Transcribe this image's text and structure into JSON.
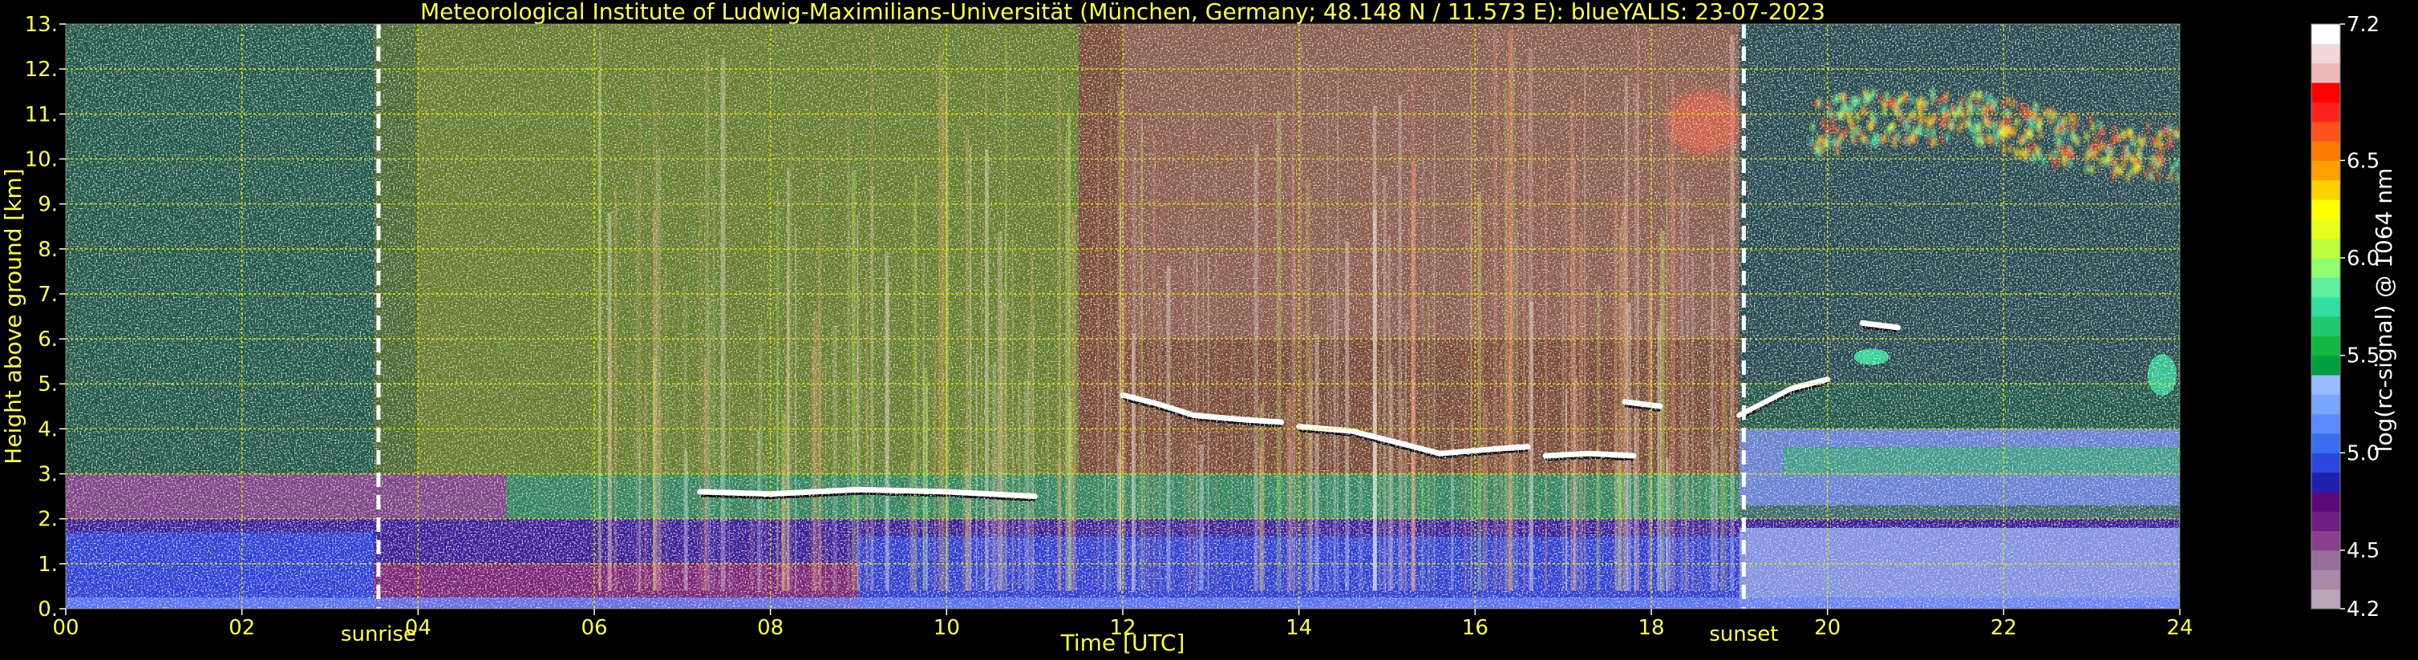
{
  "colors": {
    "background": "#000000",
    "title": "#ffff33",
    "axis_text": "#ffff33",
    "grid": "#e6e600",
    "marker": "#ffffff",
    "colorbar_text": "#ffffff"
  },
  "chart_data": {
    "type": "heatmap",
    "title": "Meteorological Institute of Ludwig-Maximilians-Universität (München, Germany; 48.148 N / 11.573 E):    blueYALIS: 23-07-2023",
    "xlabel": "Time [UTC]",
    "ylabel": "Height above ground [km]",
    "xlim": [
      0,
      24
    ],
    "ylim": [
      0,
      13
    ],
    "grid": true,
    "x_ticks": [
      0,
      2,
      4,
      6,
      8,
      10,
      12,
      14,
      16,
      18,
      20,
      22,
      24
    ],
    "x_tick_labels": [
      "00",
      "02",
      "04",
      "06",
      "08",
      "10",
      "12",
      "14",
      "16",
      "18",
      "20",
      "22",
      "24"
    ],
    "y_ticks": [
      0,
      1,
      2,
      3,
      4,
      5,
      6,
      7,
      8,
      9,
      10,
      11,
      12,
      13
    ],
    "y_tick_labels": [
      "0.",
      "1.",
      "2.",
      "3.",
      "4.",
      "5.",
      "6.",
      "7.",
      "8.",
      "9.",
      "10.",
      "11.",
      "12.",
      "13."
    ],
    "markers": [
      {
        "label": "sunrise",
        "x": 3.55
      },
      {
        "label": "sunset",
        "x": 19.05
      }
    ],
    "colorbar": {
      "label": "log(rc-signal) @ 1064 nm",
      "range": [
        4.2,
        7.2
      ],
      "tick_values": [
        4.2,
        4.5,
        5.0,
        5.5,
        6.0,
        6.5,
        7.2
      ],
      "tick_labels": [
        "4.2",
        "4.5",
        "5.0",
        "5.5",
        "6.0",
        "6.5",
        "7.2"
      ],
      "colors": [
        "#b8a6b8",
        "#a88aa8",
        "#9a6e9a",
        "#8a3f8e",
        "#6e1f82",
        "#5a0a78",
        "#2020b0",
        "#2a48e0",
        "#3a6ef0",
        "#5a8cff",
        "#78a6ff",
        "#98bcff",
        "#00a040",
        "#10b840",
        "#20c870",
        "#30e0a0",
        "#60f0a0",
        "#90ff70",
        "#c0ff40",
        "#e8ff20",
        "#ffff00",
        "#ffd000",
        "#ffa000",
        "#ff7a00",
        "#ff5020",
        "#ff2020",
        "#ff0000",
        "#f0b8b8",
        "#f0d8d8",
        "#ffffff"
      ]
    },
    "features": [
      {
        "name": "boundary layer",
        "x": [
          0,
          24
        ],
        "y": [
          0,
          2.0
        ]
      },
      {
        "name": "residual layer",
        "x": [
          0,
          5
        ],
        "y": [
          1.7,
          3.0
        ]
      },
      {
        "name": "cloud layer",
        "x": [
          11.9,
          18.1
        ],
        "y": [
          3.3,
          4.8
        ]
      },
      {
        "name": "cloud layer",
        "x": [
          6.0,
          11.5
        ],
        "y": [
          2.4,
          2.9
        ]
      },
      {
        "name": "cloud base",
        "x": [
          19.0,
          20.0
        ],
        "y": [
          4.1,
          5.2
        ]
      },
      {
        "name": "cirrus",
        "x": [
          19.8,
          24.0
        ],
        "y": [
          9.6,
          11.4
        ]
      },
      {
        "name": "aerosol above clouds",
        "x": [
          12.0,
          19.0
        ],
        "y": [
          5.0,
          11.5
        ]
      }
    ]
  }
}
